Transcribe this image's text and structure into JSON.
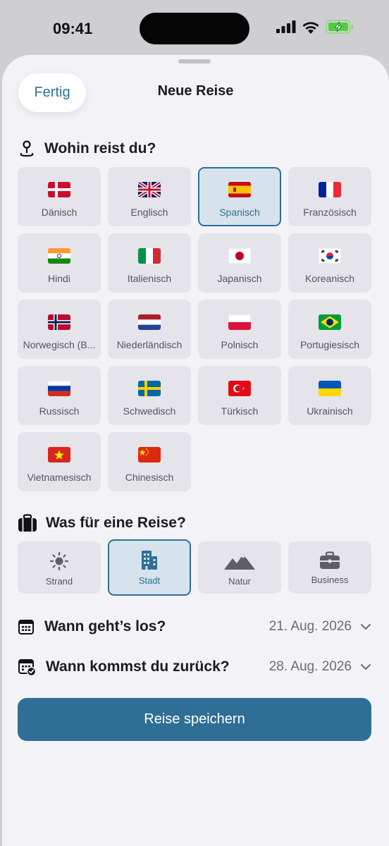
{
  "status_bar": {
    "time": "09:41"
  },
  "nav": {
    "done_label": "Fertig",
    "title": "Neue Reise"
  },
  "destination": {
    "heading": "Wohin reist du?",
    "languages": [
      {
        "label": "Dänisch",
        "flag": "denmark-flag-icon",
        "selected": false
      },
      {
        "label": "Englisch",
        "flag": "uk-flag-icon",
        "selected": false
      },
      {
        "label": "Spanisch",
        "flag": "spain-flag-icon",
        "selected": true
      },
      {
        "label": "Französisch",
        "flag": "france-flag-icon",
        "selected": false
      },
      {
        "label": "Hindi",
        "flag": "india-flag-icon",
        "selected": false
      },
      {
        "label": "Italienisch",
        "flag": "italy-flag-icon",
        "selected": false
      },
      {
        "label": "Japanisch",
        "flag": "japan-flag-icon",
        "selected": false
      },
      {
        "label": "Koreanisch",
        "flag": "korea-flag-icon",
        "selected": false
      },
      {
        "label": "Norwegisch (B...",
        "flag": "norway-flag-icon",
        "selected": false
      },
      {
        "label": "Niederländisch",
        "flag": "netherlands-flag-icon",
        "selected": false
      },
      {
        "label": "Polnisch",
        "flag": "poland-flag-icon",
        "selected": false
      },
      {
        "label": "Portugiesisch",
        "flag": "brazil-flag-icon",
        "selected": false
      },
      {
        "label": "Russisch",
        "flag": "russia-flag-icon",
        "selected": false
      },
      {
        "label": "Schwedisch",
        "flag": "sweden-flag-icon",
        "selected": false
      },
      {
        "label": "Türkisch",
        "flag": "turkey-flag-icon",
        "selected": false
      },
      {
        "label": "Ukrainisch",
        "flag": "ukraine-flag-icon",
        "selected": false
      },
      {
        "label": "Vietnamesisch",
        "flag": "vietnam-flag-icon",
        "selected": false
      },
      {
        "label": "Chinesisch",
        "flag": "china-flag-icon",
        "selected": false
      }
    ]
  },
  "trip_type": {
    "heading": "Was für eine Reise?",
    "options": [
      {
        "label": "Strand",
        "icon": "sun-icon",
        "selected": false
      },
      {
        "label": "Stadt",
        "icon": "city-building-icon",
        "selected": true
      },
      {
        "label": "Natur",
        "icon": "mountains-icon",
        "selected": false
      },
      {
        "label": "Business",
        "icon": "briefcase-icon",
        "selected": false
      }
    ]
  },
  "dates": {
    "start_label": "Wann geht’s los?",
    "start_value": "21. Aug. 2026",
    "end_label": "Wann kommst du zurück?",
    "end_value": "28. Aug. 2026"
  },
  "save_label": "Reise speichern",
  "colors": {
    "accent": "#2f6f95",
    "card_bg": "#e4e4ea",
    "selected_bg": "#d6e3ec",
    "sheet_bg": "#f2f2f7"
  }
}
